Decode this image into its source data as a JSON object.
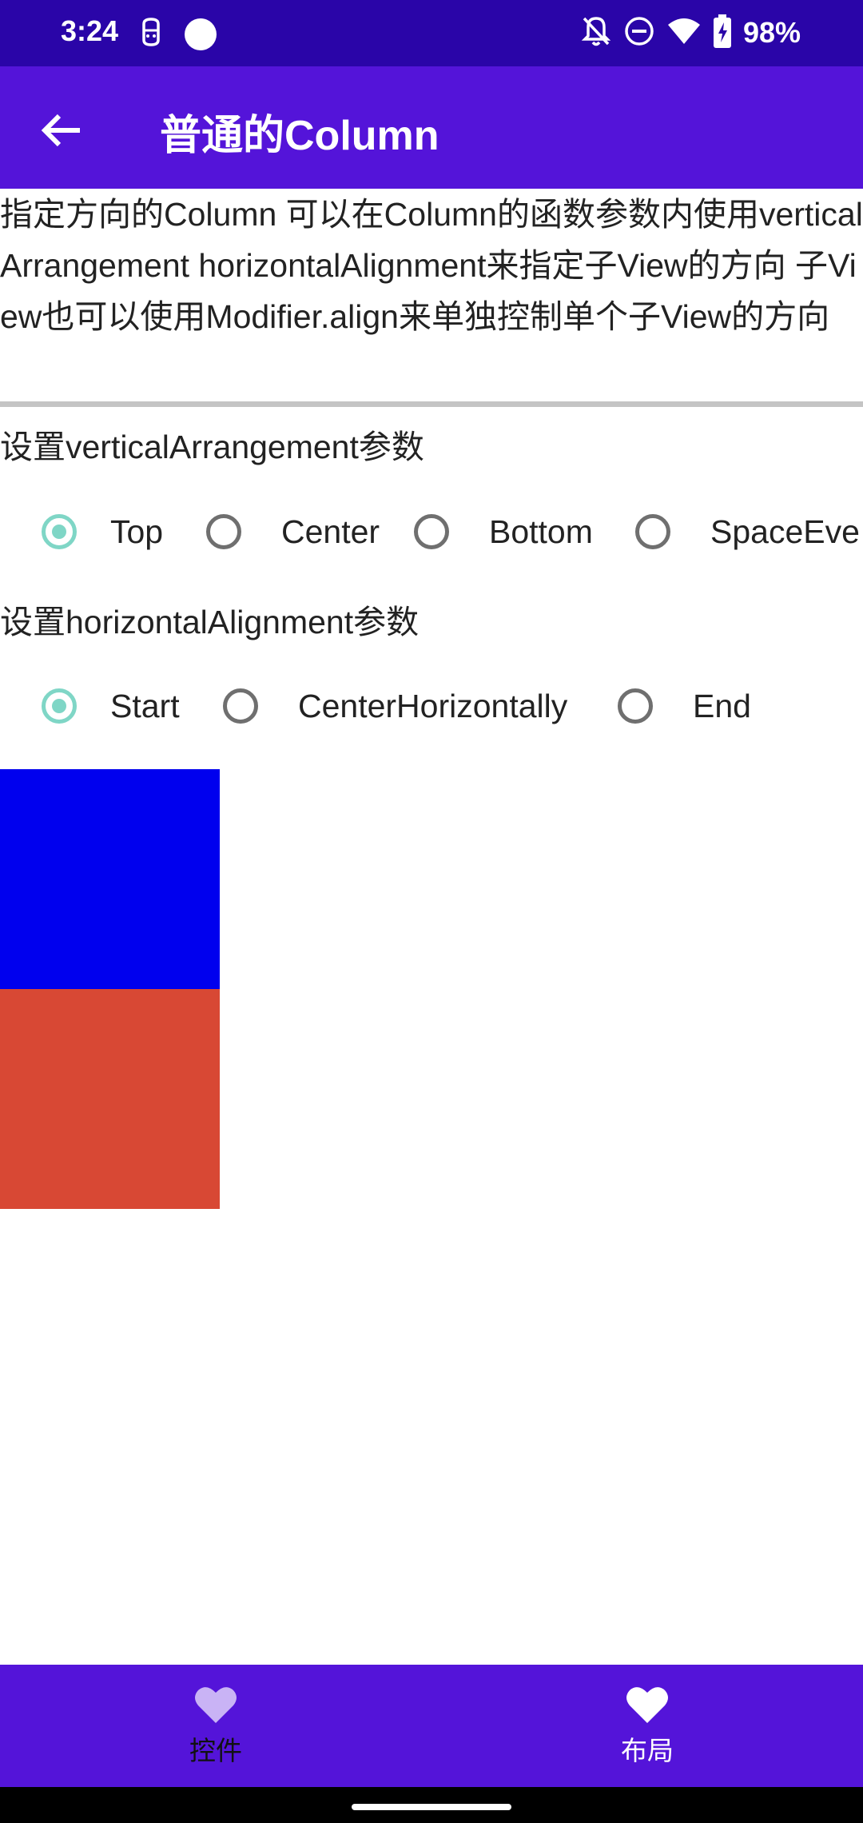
{
  "status_bar": {
    "time": "3:24",
    "battery": "98%",
    "icons": [
      "face-notification-icon",
      "circle-notification-icon",
      "bell-off-icon",
      "do-not-disturb-icon",
      "wifi-icon",
      "battery-charging-icon"
    ]
  },
  "app_bar": {
    "title": "普通的Column",
    "back_icon": "arrow-back-icon"
  },
  "description": "指定方向的Column 可以在Column的函数参数内使用verticalArrangement horizontalAlignment来指定子View的方向 子View也可以使用Modifier.align来单独控制单个子View的方向",
  "vertical_arrangement": {
    "label": "设置verticalArrangement参数",
    "options": [
      {
        "label": "Top",
        "selected": true
      },
      {
        "label": "Center",
        "selected": false
      },
      {
        "label": "Bottom",
        "selected": false
      },
      {
        "label": "SpaceEve",
        "selected": false
      }
    ]
  },
  "horizontal_alignment": {
    "label": "设置horizontalAlignment参数",
    "options": [
      {
        "label": "Start",
        "selected": true
      },
      {
        "label": "CenterHorizontally",
        "selected": false
      },
      {
        "label": "End",
        "selected": false
      }
    ]
  },
  "boxes": {
    "colors": [
      "#0000ee",
      "#d84834"
    ]
  },
  "bottom_nav": {
    "items": [
      {
        "label": "控件",
        "icon": "heart-icon",
        "active": false
      },
      {
        "label": "布局",
        "icon": "heart-icon",
        "active": true
      }
    ]
  },
  "colors": {
    "status_bar": "#2a05a8",
    "primary": "#5414d9",
    "radio_selected": "#7fd6c6",
    "nav_icon_inactive": "#c9b3f5"
  }
}
